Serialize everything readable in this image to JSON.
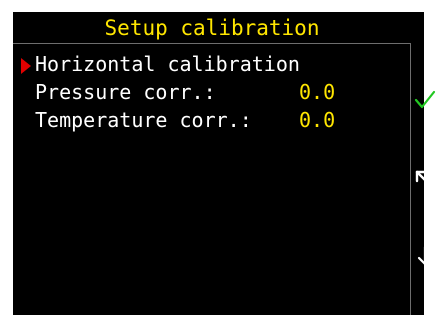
{
  "title": "Setup calibration",
  "menu": {
    "items": [
      {
        "label": "Horizontal calibration",
        "value": "",
        "selected": true
      },
      {
        "label": "Pressure corr.:",
        "value": "0.0",
        "selected": false
      },
      {
        "label": "Temperature corr.:",
        "value": "0.0",
        "selected": false
      }
    ]
  },
  "side_buttons": [
    {
      "icon": "check-icon",
      "color": "#22c822"
    },
    {
      "icon": "arrow-up-left-icon",
      "color": "#ffffff"
    },
    {
      "icon": "arrow-down-icon",
      "color": "#ffffff"
    }
  ],
  "colors": {
    "background": "#000000",
    "title": "#ffe600",
    "label": "#ffffff",
    "value": "#ffe600",
    "cursor": "#e00000",
    "divider": "#6e6e6e"
  }
}
